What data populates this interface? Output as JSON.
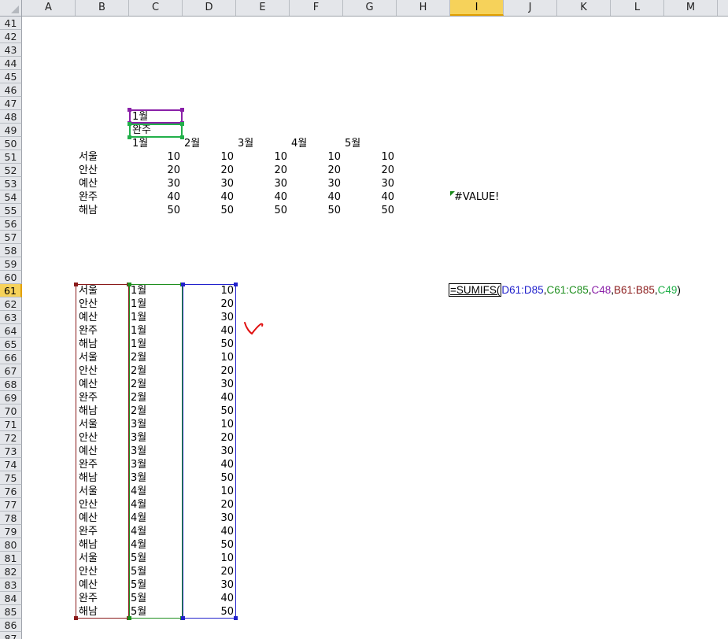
{
  "columns": [
    "A",
    "B",
    "C",
    "D",
    "E",
    "F",
    "G",
    "H",
    "I",
    "J",
    "K",
    "L",
    "M"
  ],
  "active_column": "I",
  "rows": [
    41,
    42,
    43,
    44,
    45,
    46,
    47,
    48,
    49,
    50,
    51,
    52,
    53,
    54,
    55,
    56,
    57,
    58,
    59,
    60,
    61,
    62,
    63,
    64,
    65,
    66,
    67,
    68,
    69,
    70,
    71,
    72,
    73,
    74,
    75,
    76,
    77,
    78,
    79,
    80,
    81,
    82,
    83,
    84,
    85,
    86,
    87
  ],
  "active_row": 61,
  "criteria": {
    "month": "1월",
    "region": "완주"
  },
  "summary_table": {
    "headers": [
      "1월",
      "2월",
      "3월",
      "4월",
      "5월"
    ],
    "rows": [
      {
        "region": "서울",
        "values": [
          10,
          10,
          10,
          10,
          10
        ]
      },
      {
        "region": "안산",
        "values": [
          20,
          20,
          20,
          20,
          20
        ]
      },
      {
        "region": "예산",
        "values": [
          30,
          30,
          30,
          30,
          30
        ]
      },
      {
        "region": "완주",
        "values": [
          40,
          40,
          40,
          40,
          40
        ]
      },
      {
        "region": "해남",
        "values": [
          50,
          50,
          50,
          50,
          50
        ]
      }
    ]
  },
  "error_value": "#VALUE!",
  "formula": {
    "prefix": "=SUMIFS(",
    "args": [
      {
        "text": "D61:D85",
        "color": "#2222cc"
      },
      {
        "text": "C61:C85",
        "color": "#1f8f1f"
      },
      {
        "text": "C48",
        "color": "#8a20a8"
      },
      {
        "text": "B61:B85",
        "color": "#8a1a1a"
      },
      {
        "text": "C49",
        "color": "#22b04a"
      }
    ],
    "suffix": ")"
  },
  "data_list": [
    {
      "region": "서울",
      "month": "1월",
      "value": 10
    },
    {
      "region": "안산",
      "month": "1월",
      "value": 20
    },
    {
      "region": "예산",
      "month": "1월",
      "value": 30
    },
    {
      "region": "완주",
      "month": "1월",
      "value": 40
    },
    {
      "region": "해남",
      "month": "1월",
      "value": 50
    },
    {
      "region": "서울",
      "month": "2월",
      "value": 10
    },
    {
      "region": "안산",
      "month": "2월",
      "value": 20
    },
    {
      "region": "예산",
      "month": "2월",
      "value": 30
    },
    {
      "region": "완주",
      "month": "2월",
      "value": 40
    },
    {
      "region": "해남",
      "month": "2월",
      "value": 50
    },
    {
      "region": "서울",
      "month": "3월",
      "value": 10
    },
    {
      "region": "안산",
      "month": "3월",
      "value": 20
    },
    {
      "region": "예산",
      "month": "3월",
      "value": 30
    },
    {
      "region": "완주",
      "month": "3월",
      "value": 40
    },
    {
      "region": "해남",
      "month": "3월",
      "value": 50
    },
    {
      "region": "서울",
      "month": "4월",
      "value": 10
    },
    {
      "region": "안산",
      "month": "4월",
      "value": 20
    },
    {
      "region": "예산",
      "month": "4월",
      "value": 30
    },
    {
      "region": "완주",
      "month": "4월",
      "value": 40
    },
    {
      "region": "해남",
      "month": "4월",
      "value": 50
    },
    {
      "region": "서울",
      "month": "5월",
      "value": 10
    },
    {
      "region": "안산",
      "month": "5월",
      "value": 20
    },
    {
      "region": "예산",
      "month": "5월",
      "value": 30
    },
    {
      "region": "완주",
      "month": "5월",
      "value": 40
    },
    {
      "region": "해남",
      "month": "5월",
      "value": 50
    }
  ],
  "colors": {
    "range_d": "#2222cc",
    "range_c": "#1f8f1f",
    "range_b": "#8a1a1a",
    "ref_c48": "#8a20a8",
    "ref_c49": "#22b04a",
    "annotation": "#e01010",
    "active_header": "#f6d25a"
  }
}
